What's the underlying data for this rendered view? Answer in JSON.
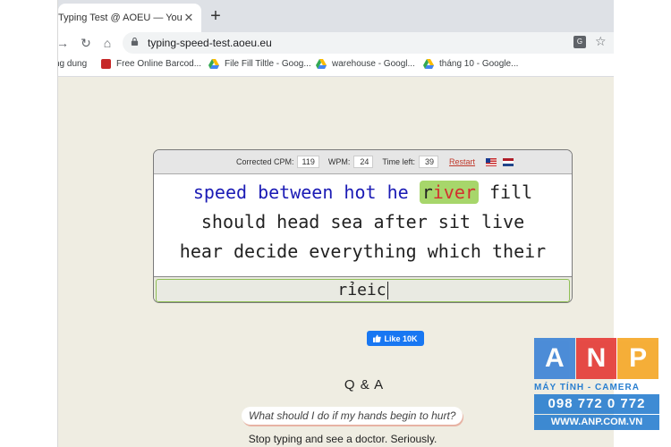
{
  "browser": {
    "tab_title": "Typing Test @ AOEU — Your typ...",
    "url": "typing-speed-test.aoeu.eu",
    "bookmarks": [
      "ng dung",
      "Free Online Barcod...",
      "File Fill Tiltle - Goog...",
      "warehouse - Googl...",
      "tháng 10 - Google..."
    ]
  },
  "stats": {
    "cpm_label": "Corrected CPM:",
    "cpm_value": "119",
    "wpm_label": "WPM:",
    "wpm_value": "24",
    "time_label": "Time left:",
    "time_value": "39",
    "restart_label": "Restart"
  },
  "words": {
    "typed": "speed between hot he",
    "current_correct": "r",
    "current_wrong": "iver",
    "line1_rest": "fill",
    "line2": "should head sea after sit live",
    "line3": "hear decide everything which their"
  },
  "input": {
    "value": "rỉeic"
  },
  "fb_like": {
    "label": "Like 10K"
  },
  "qa": {
    "title": "Q & A",
    "question": "What should I do if my hands begin to hurt?",
    "answer": "Stop typing and see a doctor. Seriously."
  },
  "watermark": {
    "letters": [
      "A",
      "N",
      "P"
    ],
    "colors": [
      "#3b82d6",
      "#e53935",
      "#f5a623"
    ],
    "subtitle": "MÁY TÍNH - CAMERA",
    "phone": "098 772 0 772",
    "website": "WWW.ANP.COM.VN"
  }
}
